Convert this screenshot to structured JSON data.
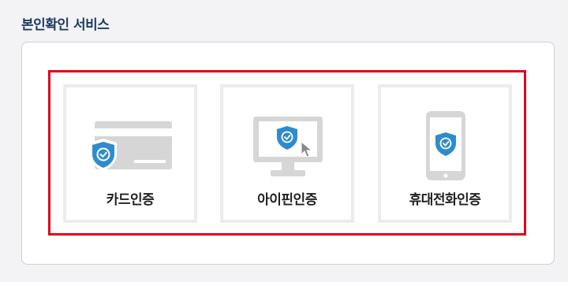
{
  "header": {
    "title": "본인확인 서비스"
  },
  "methods": [
    {
      "label": "카드인증",
      "icon": "credit-card-shield-icon"
    },
    {
      "label": "아이핀인증",
      "icon": "monitor-shield-icon"
    },
    {
      "label": "휴대전화인증",
      "icon": "mobile-phone-shield-icon"
    }
  ],
  "colors": {
    "title": "#1f3a5f",
    "highlight_border": "#e0001b",
    "shield": "#2f8ccc",
    "device_gray": "#d6d6d6"
  }
}
